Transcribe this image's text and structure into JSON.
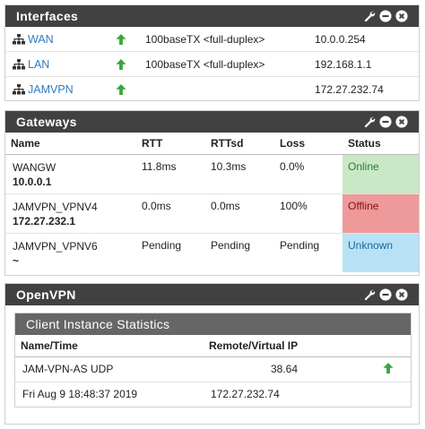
{
  "interfaces": {
    "title": "Interfaces",
    "rows": [
      {
        "name": "WAN",
        "media": "100baseTX <full-duplex>",
        "ip": "10.0.0.254"
      },
      {
        "name": "LAN",
        "media": "100baseTX <full-duplex>",
        "ip": "192.168.1.1"
      },
      {
        "name": "JAMVPN",
        "media": "",
        "ip": "172.27.232.74"
      }
    ]
  },
  "gateways": {
    "title": "Gateways",
    "headers": [
      "Name",
      "RTT",
      "RTTsd",
      "Loss",
      "Status"
    ],
    "rows": [
      {
        "name": "WANGW",
        "address": "10.0.0.1",
        "rtt": "11.8ms",
        "rttsd": "10.3ms",
        "loss": "0.0%",
        "status": "Online"
      },
      {
        "name": "JAMVPN_VPNV4",
        "address": "172.27.232.1",
        "rtt": "0.0ms",
        "rttsd": "0.0ms",
        "loss": "100%",
        "status": "Offline"
      },
      {
        "name": "JAMVPN_VPNV6",
        "address": "~",
        "rtt": "Pending",
        "rttsd": "Pending",
        "loss": "Pending",
        "status": "Unknown"
      }
    ]
  },
  "openvpn": {
    "title": "OpenVPN",
    "subtitle": "Client Instance Statistics",
    "headers": [
      "Name/Time",
      "Remote/Virtual IP"
    ],
    "rows": [
      {
        "left": "JAM-VPN-AS UDP",
        "right": "38.64"
      },
      {
        "left": "Fri Aug 9 18:48:37 2019",
        "right": "172.27.232.74"
      }
    ]
  },
  "colors": {
    "header_bg": "#414141",
    "link": "#2f7bbf",
    "up_arrow": "#3aa53a",
    "online_bg": "#c9e9c6",
    "offline_bg": "#ee9a9a",
    "unknown_bg": "#b7e2f5"
  },
  "icons": [
    "wrench-icon",
    "minimize-icon",
    "close-icon",
    "network-icon",
    "up-arrow-icon"
  ]
}
